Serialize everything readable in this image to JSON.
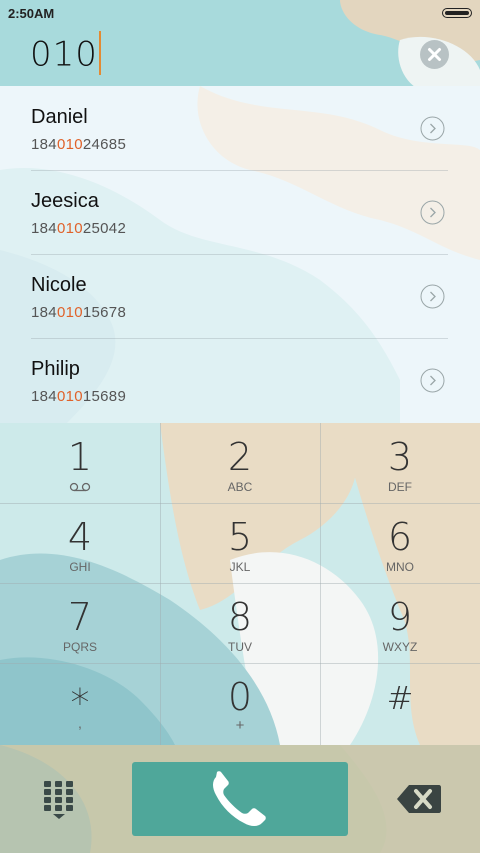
{
  "status_bar": {
    "time": "2:50AM"
  },
  "input": {
    "number": "010"
  },
  "contacts": [
    {
      "name": "Daniel",
      "number_prefix": "184",
      "number_match": "010",
      "number_suffix": "24685"
    },
    {
      "name": "Jeesica",
      "number_prefix": "184",
      "number_match": "010",
      "number_suffix": "25042"
    },
    {
      "name": "Nicole",
      "number_prefix": "184",
      "number_match": "010",
      "number_suffix": "15678"
    },
    {
      "name": "Philip",
      "number_prefix": "184",
      "number_match": "010",
      "number_suffix": "15689"
    }
  ],
  "keypad": [
    {
      "digit": "1",
      "letters": ""
    },
    {
      "digit": "2",
      "letters": "ABC"
    },
    {
      "digit": "3",
      "letters": "DEF"
    },
    {
      "digit": "4",
      "letters": "GHI"
    },
    {
      "digit": "5",
      "letters": "JKL"
    },
    {
      "digit": "6",
      "letters": "MNO"
    },
    {
      "digit": "7",
      "letters": "PQRS"
    },
    {
      "digit": "8",
      "letters": "TUV"
    },
    {
      "digit": "9",
      "letters": "WXYZ"
    },
    {
      "digit": "*",
      "letters": ","
    },
    {
      "digit": "0",
      "letters": "+"
    },
    {
      "digit": "#",
      "letters": ""
    }
  ],
  "icons": {
    "clear": "clear-circle-icon",
    "contact_arrow": "chevron-right-circle-icon",
    "voicemail": "voicemail-icon",
    "dialpad": "dialpad-icon",
    "call": "phone-icon",
    "backspace": "backspace-icon"
  },
  "colors": {
    "highlight": "#e0622a",
    "call_button": "#4fa79a",
    "cursor": "#e38a33"
  }
}
